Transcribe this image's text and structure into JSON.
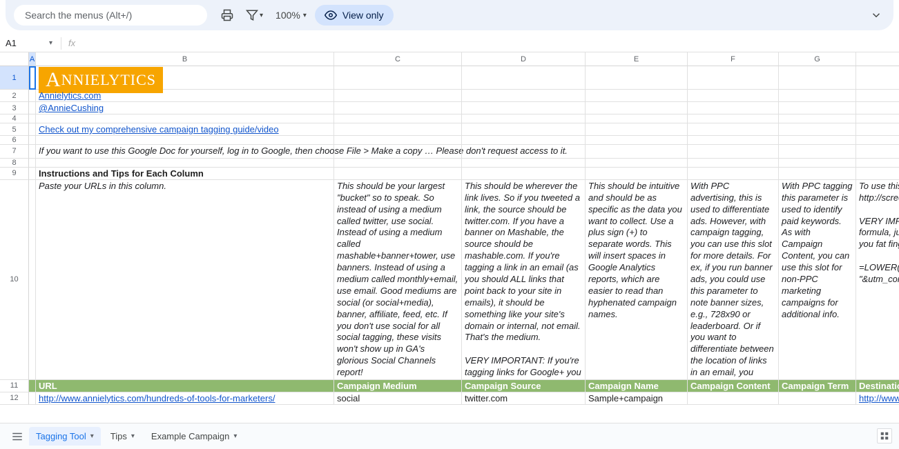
{
  "toolbar": {
    "search_placeholder": "Search the menus (Alt+/)",
    "zoom": "100%",
    "view_only": "View only"
  },
  "formula_bar": {
    "cell_ref": "A1",
    "formula": ""
  },
  "columns": [
    "A",
    "B",
    "C",
    "D",
    "E",
    "F",
    "G"
  ],
  "rows": {
    "r1": {
      "num": "1"
    },
    "r2": {
      "num": "2",
      "b": "Annielytics.com"
    },
    "r3": {
      "num": "3",
      "b": "@AnnieCushing"
    },
    "r4": {
      "num": "4"
    },
    "r5": {
      "num": "5",
      "b": "Check out my comprehensive campaign tagging guide/video"
    },
    "r6": {
      "num": "6"
    },
    "r7": {
      "num": "7",
      "b": "If you want to use this Google Doc for yourself, log in to Google, then choose File > Make a copy … Please don't request access to it."
    },
    "r8": {
      "num": "8"
    },
    "r9": {
      "num": "9",
      "b": "Instructions and Tips for Each Column"
    },
    "r10": {
      "num": "10",
      "b": "Paste your URLs in this column.",
      "c": "This should be your largest \"bucket\" so to speak. So instead of using a medium called twitter, use social. Instead of using a medium called mashable+banner+tower, use banners. Instead of using a medium called monthly+email, use email. Good mediums are social (or social+media), banner, affiliate, feed, etc. If you don't use social for all social tagging, these visits won't show up in GA's glorious Social Channels report!",
      "d": "This should be wherever the link lives. So if you tweeted a link, the source should be twitter.com. If you have a banner on Mashable, the source should be mashable.com. If you're tagging a link in an email (as you should ALL links that point back to your site in emails), it should be something like your site's domain or internal, not email. That's the medium.\n\nVERY IMPORTANT: If you're tagging links for Google+ you must set the source to plus.google.com or plus.url.google.com for it to route to your social reports correctly.",
      "e": "This should be intuitive and should be as specific as the data you want to collect. Use a plus sign (+) to separate words. This will insert spaces in Google Analytics reports, which are easier to read than hyphenated campaign names.",
      "f": "With PPC advertising, this is used to differentiate ads. However, with campaign tagging, you can use this slot for more details. For ex, if you run banner ads, you could use this parameter to note banner sizes, e.g., 728x90 or leaderboard. Or if you want to differentiate between the location of links in an email, you could assign values like body+copy, footer, image, etc. to your links.",
      "g": "With PPC tagging this parameter is used to identify paid keywords. As with Campaign Content, you can use this slot for non-PPC marketing campaigns for additional info.",
      "h": "To use this\nhttp://scree\n\nVERY IMPO\nformula, jus\nyou fat finge\n\n=LOWER(I\n\"&utm_cont"
    },
    "r11": {
      "num": "11",
      "b": "URL",
      "c": "Campaign Medium",
      "d": "Campaign Source",
      "e": "Campaign Name",
      "f": "Campaign Content",
      "g": "Campaign Term",
      "h": "Destinatio"
    },
    "r12": {
      "num": "12",
      "b": "http://www.annielytics.com/hundreds-of-tools-for-marketers/",
      "c": "social",
      "d": "twitter.com",
      "e": "Sample+campaign",
      "f": "",
      "g": "",
      "h": "http://www"
    }
  },
  "tabs": [
    {
      "label": "Tagging Tool",
      "active": true
    },
    {
      "label": "Tips",
      "active": false
    },
    {
      "label": "Example Campaign",
      "active": false
    }
  ],
  "logo_text": "NNIELYTICS"
}
